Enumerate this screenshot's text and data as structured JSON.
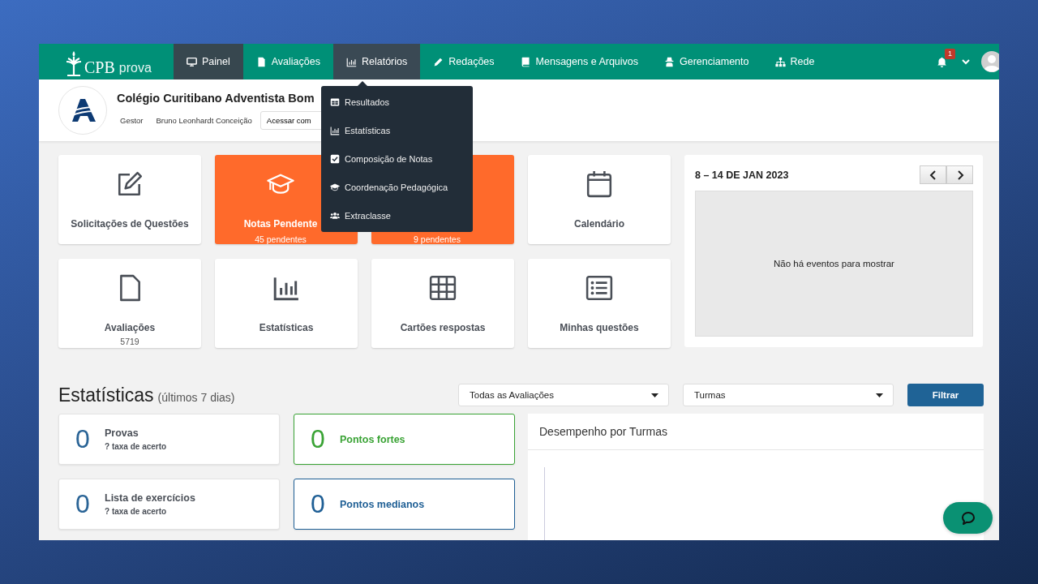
{
  "brand": {
    "mark": "CPB",
    "name": "prova"
  },
  "nav": [
    {
      "label": "Painel",
      "selected": true,
      "expanded": false
    },
    {
      "label": "Avaliações",
      "selected": false,
      "expanded": false
    },
    {
      "label": "Relatórios",
      "selected": false,
      "expanded": true
    },
    {
      "label": "Redações",
      "selected": false,
      "expanded": false
    },
    {
      "label": "Mensagens e Arquivos",
      "selected": false,
      "expanded": false
    },
    {
      "label": "Gerenciamento",
      "selected": false,
      "expanded": false
    },
    {
      "label": "Rede",
      "selected": false,
      "expanded": false
    }
  ],
  "notifications": {
    "count": "1"
  },
  "menu": [
    {
      "label": "Resultados"
    },
    {
      "label": "Estatísticas"
    },
    {
      "label": "Composição de Notas"
    },
    {
      "label": "Coordenação Pedagógica"
    },
    {
      "label": "Extraclasse"
    }
  ],
  "school": {
    "name": "Colégio Curitibano Adventista Bom",
    "role": "Gestor",
    "user": "Bruno Leonhardt Conceição",
    "access_button": "Acessar com"
  },
  "cards": [
    {
      "kind": "plain",
      "title": "Solicitações de Questões"
    },
    {
      "kind": "highlight",
      "title": "Notas Pendente",
      "subtitle": "45 pendentes"
    },
    {
      "kind": "highlight",
      "subtitle": "9 pendentes"
    },
    {
      "kind": "plain",
      "title": "Calendário"
    },
    {
      "kind": "plain",
      "title": "Avaliações",
      "subtitle": "5719"
    },
    {
      "kind": "plain",
      "title": "Estatísticas"
    },
    {
      "kind": "plain",
      "title": "Cartões respostas"
    },
    {
      "kind": "plain",
      "title": "Minhas questões"
    }
  ],
  "calendar": {
    "range": "8 – 14 DE JAN 2023",
    "empty_message": "Não há eventos para mostrar"
  },
  "statistics": {
    "title": "Estatísticas",
    "period": "(últimos 7 dias)",
    "filters": [
      {
        "value": "Todas as Avaliações"
      },
      {
        "value": "Turmas"
      }
    ],
    "filter_button": "Filtrar",
    "counters": [
      {
        "value": "0",
        "title": "Provas",
        "subtitle": "? taxa de acerto",
        "color": "#2a6496"
      },
      {
        "value": "0",
        "title": "Pontos fortes",
        "color": "#3aa335"
      },
      {
        "value": "0",
        "title": "Lista de exercícios",
        "subtitle": "? taxa de acerto",
        "color": "#2a6496"
      },
      {
        "value": "0",
        "title": "Pontos medianos",
        "color": "#1f5f95"
      }
    ],
    "chart_title": "Desempenho por Turmas"
  }
}
